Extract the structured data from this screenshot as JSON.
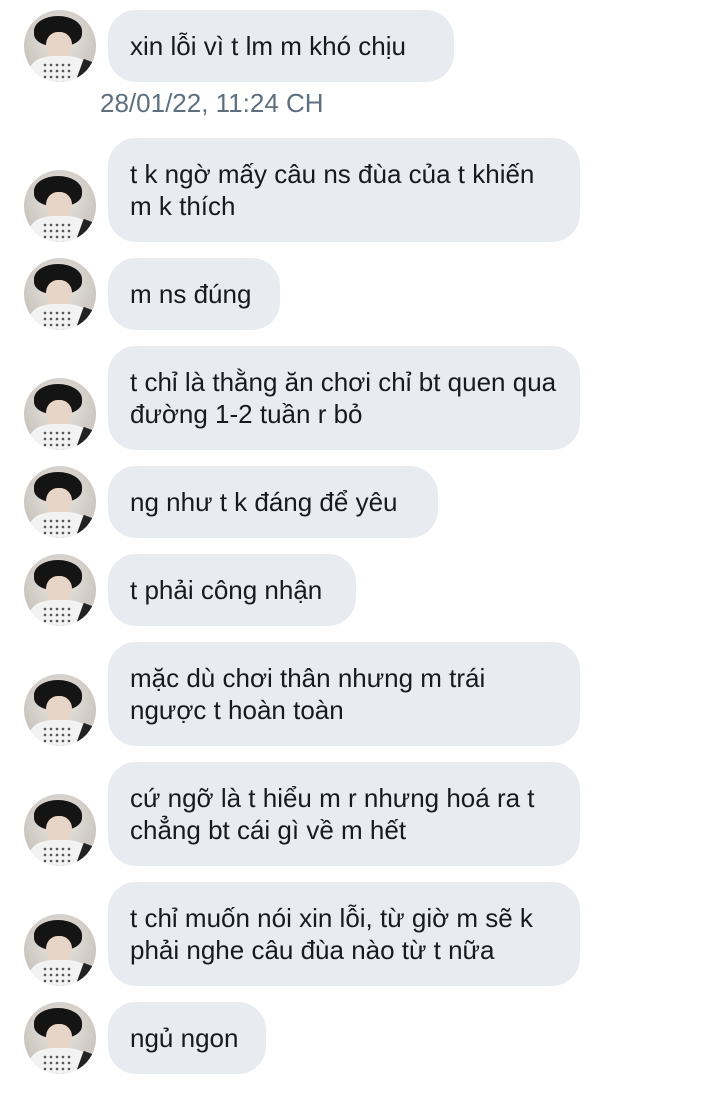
{
  "messages": [
    {
      "text": "xin lỗi vì t lm m khó chịu"
    },
    {
      "text": "t k ngờ mấy câu ns đùa của t khiến m k thích"
    },
    {
      "text": "m ns đúng"
    },
    {
      "text": "t chỉ là thằng ăn chơi chỉ bt quen qua đường 1-2 tuần r bỏ"
    },
    {
      "text": "ng như t k đáng để yêu"
    },
    {
      "text": "t phải công nhận"
    },
    {
      "text": "mặc dù chơi thân nhưng m trái ngược t hoàn toàn"
    },
    {
      "text": "cứ ngỡ là t hiểu m r nhưng hoá ra t chẳng bt cái gì về m hết"
    },
    {
      "text": "t chỉ muốn nói xin lỗi, từ giờ m sẽ k phải nghe câu đùa nào từ t nữa"
    },
    {
      "text": "ngủ ngon"
    }
  ],
  "timestamp": "28/01/22, 11:24 CH",
  "colors": {
    "bubble_bg": "#e8ebf0",
    "text": "#161b21",
    "timestamp": "#5e6f80"
  },
  "icons": {
    "avatar": "avatar-photo"
  }
}
